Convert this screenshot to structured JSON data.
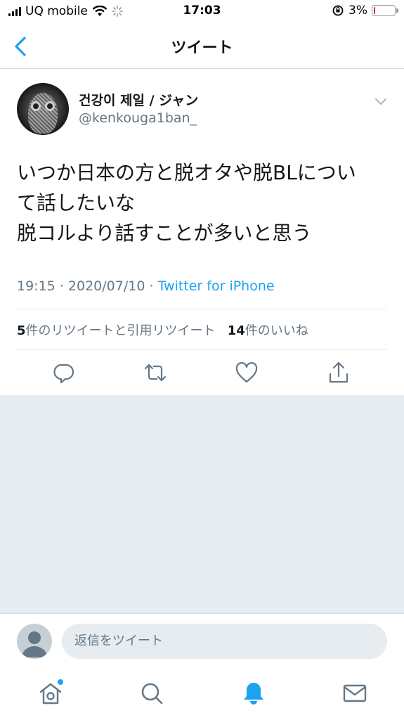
{
  "status_bar": {
    "carrier": "UQ mobile",
    "time": "17:03",
    "battery_percent_label": "3%",
    "battery_level": 0.03
  },
  "nav": {
    "title": "ツイート"
  },
  "tweet": {
    "display_name": "건강이 제일 / ジャン",
    "handle": "@kenkouga1ban_",
    "text_lines": [
      "いつか日本の方と脱オタや脱BLについ",
      "て話したいな",
      "脱コルより話すことが多いと思う"
    ],
    "time": "19:15",
    "date": "2020/07/10",
    "sep": "·",
    "source": "Twitter for iPhone",
    "retweet_count": "5",
    "retweet_label": "件のリツイートと引用リツイート",
    "like_count": "14",
    "like_label": "件のいいね"
  },
  "actions": [
    "reply-icon",
    "retweet-icon",
    "like-icon",
    "share-icon"
  ],
  "reply": {
    "placeholder": "返信をツイート"
  },
  "tabs": [
    "home-icon",
    "search-icon",
    "notifications-icon",
    "messages-icon"
  ],
  "colors": {
    "accent": "#1da1f2",
    "secondary_text": "#657786",
    "background_gray": "#e6ecf0",
    "battery_low": "#e0245e"
  }
}
